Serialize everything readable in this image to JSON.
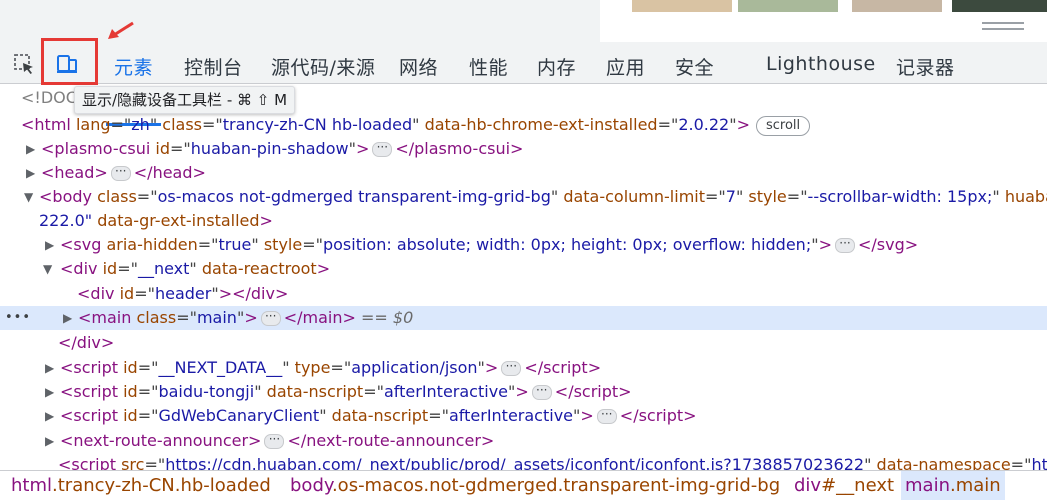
{
  "tooltip": {
    "text": "显示/隐藏设备工具栏 - ⌘ ⇧ M"
  },
  "toolbar": {
    "icons": [
      "element-picker-icon",
      "device-toolbar-icon"
    ],
    "tabs": [
      {
        "label": "元素",
        "active": true
      },
      {
        "label": "控制台"
      },
      {
        "label": "源代码/来源"
      },
      {
        "label": "网络"
      },
      {
        "label": "性能"
      },
      {
        "label": "内存"
      },
      {
        "label": "应用"
      },
      {
        "label": "安全"
      },
      {
        "label": "Lighthouse"
      },
      {
        "label": "记录器"
      }
    ]
  },
  "dom": {
    "doctype_fragment": "<!DOC",
    "html_open": {
      "tag": "html",
      "attrs": [
        [
          "lang",
          "zh"
        ],
        [
          "class",
          "trancy-zh-CN hb-loaded"
        ],
        [
          "data-hb-chrome-ext-installed",
          "2.0.22"
        ]
      ],
      "badge": "scroll"
    },
    "plasmo": {
      "tag": "plasmo-csui",
      "attrs": [
        [
          "id",
          "huaban-pin-shadow"
        ]
      ]
    },
    "head": {
      "tag": "head"
    },
    "body_open": {
      "tag": "body",
      "attrs": [
        [
          "class",
          "os-macos not-gdmerged transparent-img-grid-bg"
        ],
        [
          "data-column-limit",
          "7"
        ],
        [
          "style",
          "--scrollbar-width: 15px;"
        ]
      ],
      "overflow_tail": "huaba"
    },
    "body_cont": {
      "text": "222.0\"",
      "attr": "data-gr-ext-installed"
    },
    "svg": {
      "tag": "svg",
      "attrs": [
        [
          "aria-hidden",
          "true"
        ],
        [
          "style",
          "position: absolute; width: 0px; height: 0px; overflow: hidden;"
        ]
      ]
    },
    "div_next": {
      "tag": "div",
      "attrs": [
        [
          "id",
          "__next"
        ],
        [
          "data-reactroot",
          ""
        ]
      ]
    },
    "div_header": {
      "tag": "div",
      "attrs": [
        [
          "id",
          "header"
        ]
      ]
    },
    "main": {
      "tag": "main",
      "attrs": [
        [
          "class",
          "main"
        ]
      ],
      "eq": "== $0"
    },
    "div_close": {
      "tag": "div"
    },
    "script1": {
      "tag": "script",
      "attrs": [
        [
          "id",
          "__NEXT_DATA__"
        ],
        [
          "type",
          "application/json"
        ]
      ]
    },
    "script2": {
      "tag": "script",
      "attrs": [
        [
          "id",
          "baidu-tongji"
        ],
        [
          "data-nscript",
          "afterInteractive"
        ]
      ]
    },
    "script3": {
      "tag": "script",
      "attrs": [
        [
          "id",
          "GdWebCanaryClient"
        ],
        [
          "data-nscript",
          "afterInteractive"
        ]
      ]
    },
    "announcer": {
      "tag": "next-route-announcer"
    },
    "script_src": {
      "tag": "script",
      "src": "https://cdn.huaban.com/_next/public/prod/_assets/iconfont/iconfont.js?1738857023622",
      "tail_attr": "data-namespace",
      "tail_val": "htt"
    }
  },
  "breadcrumbs": [
    {
      "tag": "html",
      "cls": ".trancy-zh-CN.hb-loaded"
    },
    {
      "tag": "body",
      "cls": ".os-macos.not-gdmerged.transparent-img-grid-bg"
    },
    {
      "tag": "div",
      "cls": "#__next"
    },
    {
      "tag": "main",
      "cls": ".main",
      "current": true
    }
  ],
  "colors": {
    "accent": "#1a73e8",
    "highlight_box": "#e53935",
    "selected_row": "#dbe8fc"
  }
}
